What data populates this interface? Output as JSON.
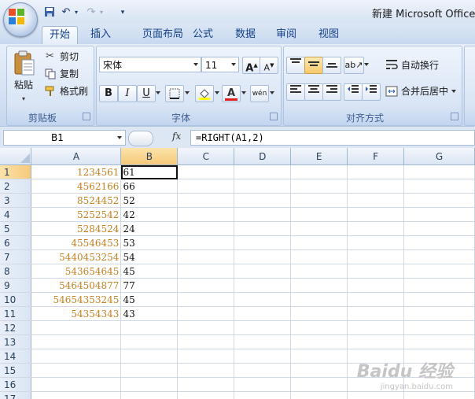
{
  "title": {
    "text": "新建 Microsoft Office E"
  },
  "tabs": [
    "开始",
    "插入",
    "页面布局",
    "公式",
    "数据",
    "审阅",
    "视图"
  ],
  "clipboard": {
    "paste": "粘贴",
    "cut": "剪切",
    "copy": "复制",
    "format_painter": "格式刷",
    "label": "剪贴板"
  },
  "font": {
    "name": "宋体",
    "size": "11",
    "bold": "B",
    "italic": "I",
    "underline": "U",
    "grow": "A",
    "shrink": "A",
    "label": "字体"
  },
  "alignment": {
    "wrap": "自动换行",
    "merge": "合并后居中",
    "label": "对齐方式"
  },
  "formula_bar": {
    "name_box": "B1",
    "fx": "fx",
    "formula": "=RIGHT(A1,2)"
  },
  "sheet": {
    "columns": [
      "A",
      "B",
      "C",
      "D",
      "E",
      "F",
      "G"
    ],
    "rows": [
      {
        "n": "1",
        "a": "1234561",
        "b": "61"
      },
      {
        "n": "2",
        "a": "4562166",
        "b": "66"
      },
      {
        "n": "3",
        "a": "8524452",
        "b": "52"
      },
      {
        "n": "4",
        "a": "5252542",
        "b": "42"
      },
      {
        "n": "5",
        "a": "5284524",
        "b": "24"
      },
      {
        "n": "6",
        "a": "45546453",
        "b": "53"
      },
      {
        "n": "7",
        "a": "5440453254",
        "b": "54"
      },
      {
        "n": "8",
        "a": "543654645",
        "b": "45"
      },
      {
        "n": "9",
        "a": "5464504877",
        "b": "77"
      },
      {
        "n": "10",
        "a": "54654353245",
        "b": "45"
      },
      {
        "n": "11",
        "a": "54354343",
        "b": "43"
      },
      {
        "n": "12",
        "a": "",
        "b": ""
      },
      {
        "n": "13",
        "a": "",
        "b": ""
      },
      {
        "n": "14",
        "a": "",
        "b": ""
      },
      {
        "n": "15",
        "a": "",
        "b": ""
      },
      {
        "n": "16",
        "a": "",
        "b": ""
      },
      {
        "n": "17",
        "a": "",
        "b": ""
      }
    ]
  },
  "watermark": {
    "brand": "Baidu 经验",
    "url": "jingyan.baidu.com"
  }
}
